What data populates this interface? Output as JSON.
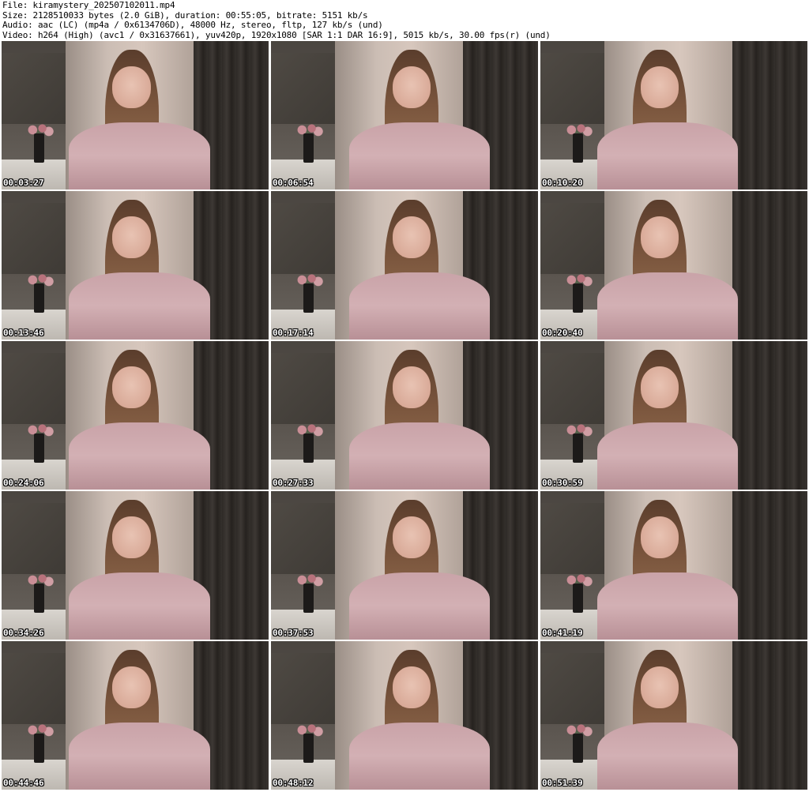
{
  "header": {
    "file_line": "File: kiramystery_202507102011.mp4",
    "size_line": "Size: 2128510033 bytes (2.0 GiB), duration: 00:55:05, bitrate: 5151 kb/s",
    "audio_line": "Audio: aac (LC) (mp4a / 0x6134706D), 48000 Hz, stereo, fltp, 127 kb/s (und)",
    "video_line": "Video: h264 (High) (avc1 / 0x31637661), yuv420p, 1920x1080 [SAR 1:1 DAR 16:9], 5015 kb/s, 30.00 fps(r) (und)"
  },
  "frames": [
    {
      "timestamp": "00:03:27"
    },
    {
      "timestamp": "00:06:54"
    },
    {
      "timestamp": "00:10:20"
    },
    {
      "timestamp": "00:13:46"
    },
    {
      "timestamp": "00:17:14"
    },
    {
      "timestamp": "00:20:40"
    },
    {
      "timestamp": "00:24:06"
    },
    {
      "timestamp": "00:27:33"
    },
    {
      "timestamp": "00:30:59"
    },
    {
      "timestamp": "00:34:26"
    },
    {
      "timestamp": "00:37:53"
    },
    {
      "timestamp": "00:41:19"
    },
    {
      "timestamp": "00:44:46"
    },
    {
      "timestamp": "00:48:12"
    },
    {
      "timestamp": "00:51:39"
    }
  ]
}
